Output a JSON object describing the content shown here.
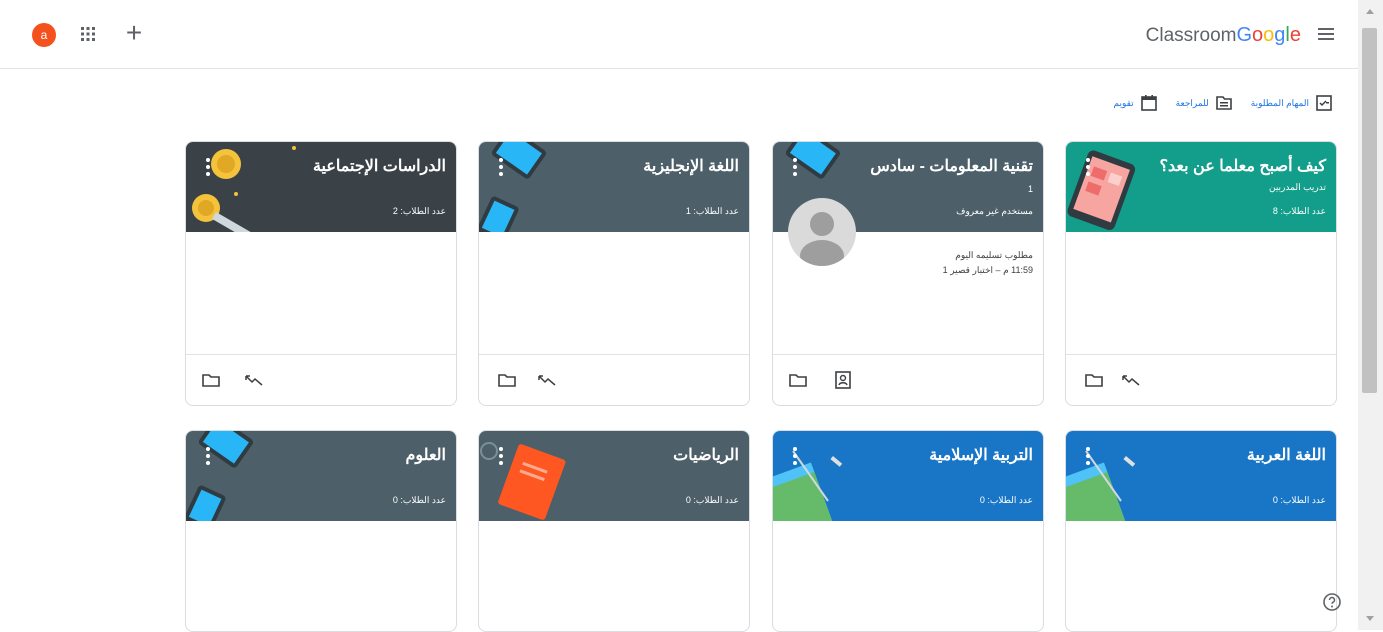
{
  "header": {
    "account_initial": "a",
    "brand_google": [
      "G",
      "o",
      "o",
      "g",
      "l",
      "e"
    ],
    "brand_product": "Classroom"
  },
  "toolbar": {
    "todo_label": "المهام المطلوبة",
    "review_label": "للمراجعة",
    "calendar_label": "تقويم"
  },
  "cards": [
    {
      "title": "كيف أصبح معلما عن بعد؟",
      "section": "تدريب المدربين",
      "students": "عدد الطلاب: 8",
      "color": "#129e8a"
    },
    {
      "title": "تقنية المعلومات - سادس",
      "section": "1",
      "teacher": "مستخدم غير معروف",
      "students": "",
      "color": "#4d5f68",
      "due_heading": "مطلوب تسليمه اليوم",
      "due_item": "11:59 م – اختبار قصير 1"
    },
    {
      "title": "اللغة الإنجليزية",
      "students": "عدد الطلاب: 1",
      "color": "#4d5f68"
    },
    {
      "title": "الدراسات الإجتماعية",
      "students": "عدد الطلاب: 2",
      "color": "#3a4248"
    },
    {
      "title": "اللغة العربية",
      "students": "عدد الطلاب: 0",
      "color": "#1976c6"
    },
    {
      "title": "التربية الإسلامية",
      "students": "عدد الطلاب: 0",
      "color": "#1976c6"
    },
    {
      "title": "الرياضيات",
      "students": "عدد الطلاب: 0",
      "color": "#4d5f68"
    },
    {
      "title": "العلوم",
      "students": "عدد الطلاب: 0",
      "color": "#4d5f68"
    }
  ],
  "icons": {
    "apps": "apps-grid-icon",
    "create": "plus-icon",
    "menu": "hamburger-menu-icon",
    "folder": "folder-icon",
    "trending": "trending-icon",
    "gradebook": "gradebook-icon",
    "help": "help-icon"
  }
}
